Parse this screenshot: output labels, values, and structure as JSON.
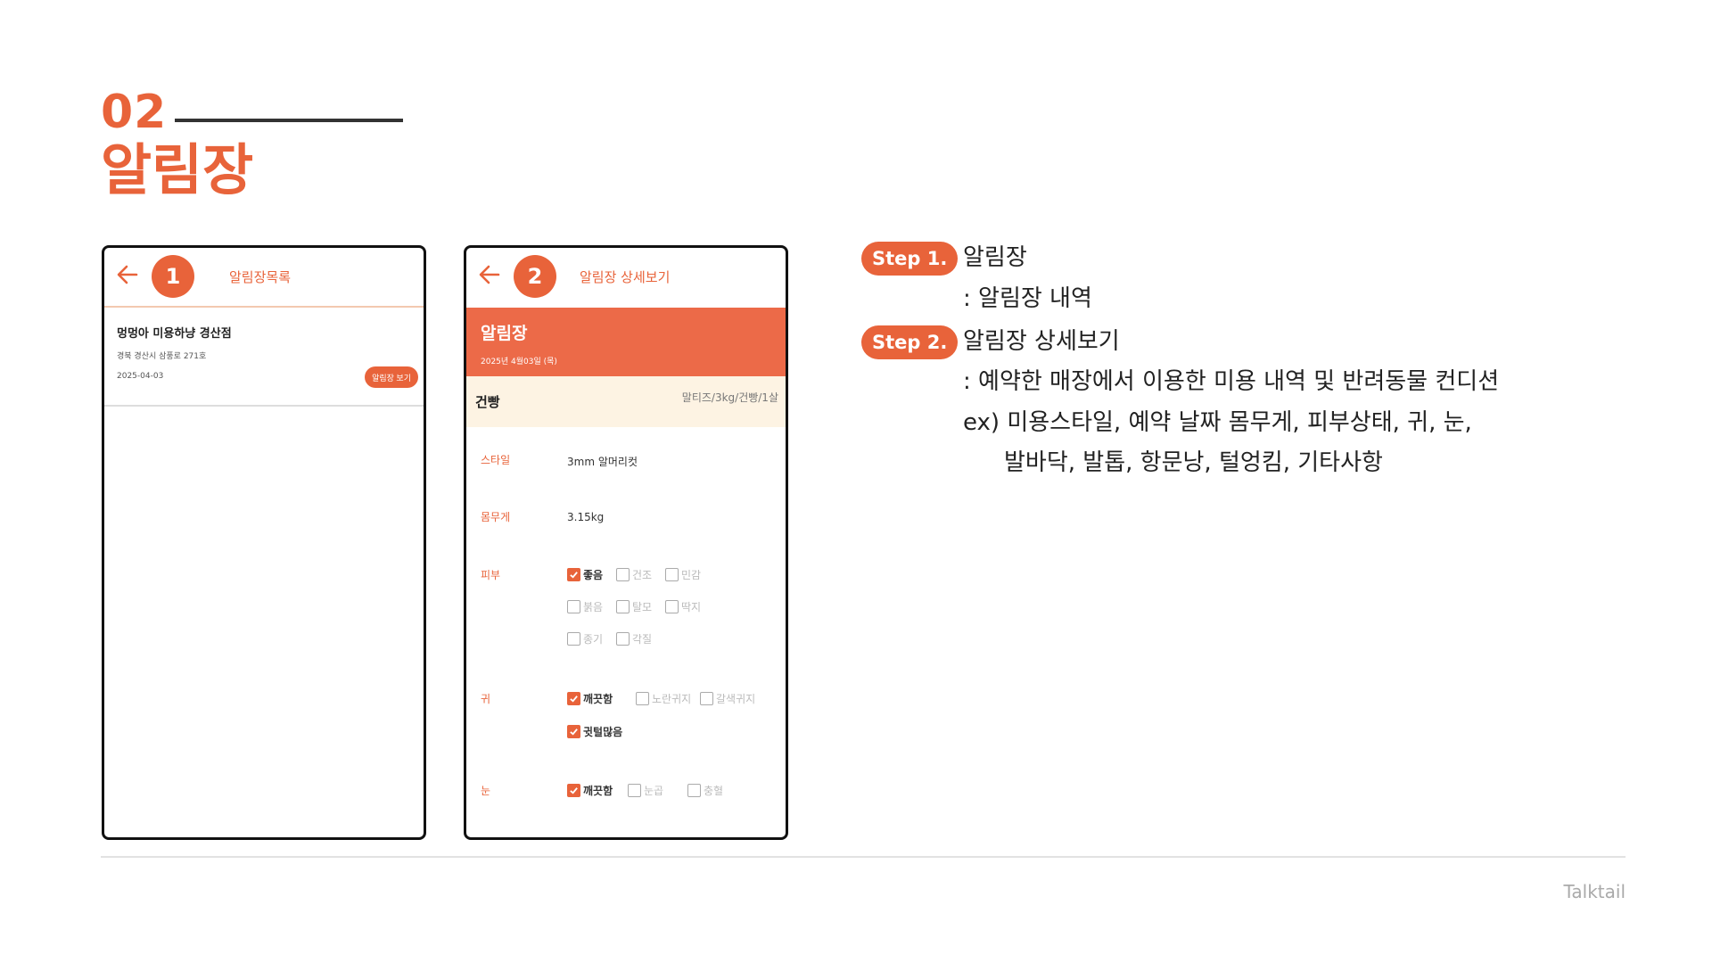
{
  "section": {
    "number": "02",
    "title": "알림장"
  },
  "phone1": {
    "badge": "1",
    "title": "알림장목록",
    "item": {
      "name": "멍멍아 미용하냥 경산점",
      "address": "경북 경산시 삼풍로 271호",
      "date": "2025-04-03",
      "button": "알림장 보기"
    }
  },
  "phone2": {
    "badge": "2",
    "title": "알림장 상세보기",
    "banner": {
      "title": "알림장",
      "date": "2025년 4월03일 (목)"
    },
    "pet": {
      "name": "건빵",
      "info": "말티즈/3kg/건빵/1살"
    },
    "style": {
      "label": "스타일",
      "value": "3mm 알머리컷"
    },
    "weight": {
      "label": "몸무게",
      "value": "3.15kg"
    },
    "skin": {
      "label": "피부",
      "options": [
        {
          "text": "좋음",
          "checked": true
        },
        {
          "text": "건조",
          "checked": false
        },
        {
          "text": "민감",
          "checked": false
        },
        {
          "text": "붉음",
          "checked": false
        },
        {
          "text": "탈모",
          "checked": false
        },
        {
          "text": "딱지",
          "checked": false
        },
        {
          "text": "종기",
          "checked": false
        },
        {
          "text": "각질",
          "checked": false
        }
      ]
    },
    "ear": {
      "label": "귀",
      "options": [
        {
          "text": "깨끗함",
          "checked": true
        },
        {
          "text": "노란귀지",
          "checked": false
        },
        {
          "text": "갈색귀지",
          "checked": false
        },
        {
          "text": "귓털많음",
          "checked": true
        }
      ]
    },
    "eye": {
      "label": "눈",
      "options": [
        {
          "text": "깨끗함",
          "checked": true
        },
        {
          "text": "눈곱",
          "checked": false
        },
        {
          "text": "충혈",
          "checked": false
        }
      ]
    }
  },
  "steps": {
    "step1": {
      "pill": "Step 1.",
      "title": "알림장",
      "desc": ": 알림장 내역"
    },
    "step2": {
      "pill": "Step 2.",
      "title": "알림장 상세보기",
      "desc": ": 예약한 매장에서 이용한 미용 내역 및 반려동물 컨디션",
      "ex1": "ex) 미용스타일, 예약 날짜 몸무게, 피부상태, 귀, 눈,",
      "ex2": "발바닥, 발톱, 항문낭, 털엉킴, 기타사항"
    }
  },
  "footer": {
    "brand": "Talktail"
  },
  "colors": {
    "accent": "#E8633A",
    "banner": "#EC6A48",
    "pet_bg": "#FDF3E3"
  }
}
